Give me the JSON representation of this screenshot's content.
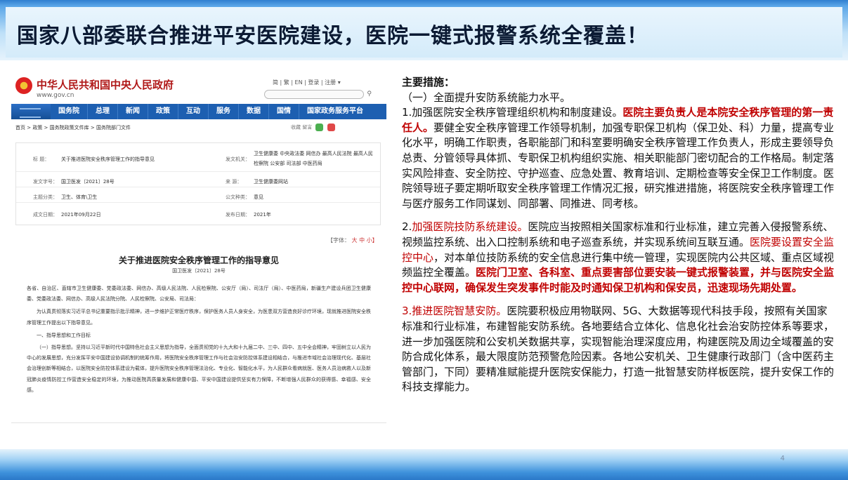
{
  "slide": {
    "title": "国家八部委联合推进平安医院建设，医院一键式报警系统全覆盖！",
    "page_number": "4"
  },
  "doc": {
    "site_name": "中华人民共和国中央人民政府",
    "site_domain": "www.gov.cn",
    "top_links": "简 | 繁 | EN | 登录 | 注册 ▾",
    "nav": [
      "国务院",
      "总理",
      "新闻",
      "政策",
      "互动",
      "服务",
      "数据",
      "国情",
      "国家政务服务平台"
    ],
    "breadcrumb": "首页 > 政策 > 国务院政策文件库 > 国务院部门文件",
    "tools": "收藏   留言",
    "meta": {
      "title_label": "标    题：",
      "title_value": "关于推进医院安全秩序管理工作的指导意见",
      "issuer_label": "发文机关：",
      "issuer_value_1": "卫生健康委  中央政法委  网信办  最高人民法院  最高人民",
      "issuer_value_2": "检察院  公安部  司法部  中医药局",
      "number_label": "发文字号：",
      "number_value": "国卫医发〔2021〕28号",
      "source_label": "来    源：",
      "source_value": "卫生健康委网站",
      "topic_label": "主题分类：",
      "topic_value": "卫生、体育\\卫生",
      "type_label": "公文种类：",
      "type_value": "意见",
      "written_label": "成文日期：",
      "written_value": "2021年09月22日",
      "published_label": "发布日期：",
      "published_value": "2021年"
    },
    "font_size_label": "【字体：",
    "font_size_big": "大",
    "font_size_mid": "中",
    "font_size_small": "小】",
    "doc_title": "关于推进医院安全秩序管理工作的指导意见",
    "doc_number": "国卫医发〔2021〕28号",
    "body_1": "各省、自治区、直辖市卫生健康委、党委政法委、网信办、高级人民法院、人民检察院、公安厅（局）、司法厅（局）、中医药局，新疆生产建设兵团卫生健康委、党委政法委、网信办、高级人民法院分院、人民检察院、公安局、司法局：",
    "body_2": "为认真贯彻落实习近平总书记重要指示批示精神，进一步维护正常医疗秩序，保护医务人员人身安全，为医患双方营造良好诊疗环境，现就推进医院安全秩序管理工作提出以下指导意见。",
    "section_1": "一、指导思想和工作目标",
    "body_3": "（一）指导思想。坚持以习近平新时代中国特色社会主义思想为指导，全面贯彻党的十九大和十九届二中、三中、四中、五中全会精神，牢固树立以人民为中心的发展思想，充分发挥平安中国建设协调机制的统筹作用，将医院安全秩序管理工作与社会治安防控体系建设相结合，与推进市域社会治理现代化、基层社会治理创新等相结合，以医院安全防控体系建设为载体，提升医院安全秩序管理法治化、专业化、智能化水平，为人民群众看病就医、医务人员治病救人以及新冠肺炎疫情防控工作营造安全稳定的环境，为推动医院高质量发展和健康中国、平安中国建设提供坚实有力保障，不断增强人民群众的获得感、幸福感、安全感。"
  },
  "measures": {
    "heading": "主要措施：",
    "sub_1": "（一）全面提升安防系统能力水平。",
    "p1_a": "1.加强医院安全秩序管理组织机构和制度建设。",
    "p1_red": "医院主要负责人是本院安全秩序管理的第一责任人。",
    "p1_b": "要健全安全秩序管理工作领导机制，加强专职保卫机构（保卫处、科）力量，提高专业化水平，明确工作职责，各职能部门和科室要明确安全秩序管理工作负责人，形成主要领导负总责、分管领导具体抓、专职保卫机构组织实施、相关职能部门密切配合的工作格局。制定落实风险排查、安全防控、守护巡查、应急处置、教育培训、定期检查等安全保卫工作制度。医院领导班子要定期听取安全秩序管理工作情况汇报，研究推进措施，将医院安全秩序管理工作与医疗服务工作同谋划、同部署、同推进、同考核。",
    "p2_num": "2.",
    "p2_red": "加强医院技防系统建设。",
    "p2_a": "医院应当按照相关国家标准和行业标准，建立完善入侵报警系统、视频监控系统、出入口控制系统和电子巡查系统，并实现系统间互联互通。",
    "p2_red2": "医院要设置安全监控中心",
    "p2_b": "，对本单位技防系统的安全信息进行集中统一管理，实现医院内公共区域、重点区域视频监控全覆盖。",
    "p2_redb": "医院门卫室、各科室、重点要害部位要安装一键式报警装置，并与医院安全监控中心联网，确保发生突发事件时能及时通知保卫机构和保安员，迅速现场先期处置。",
    "p3_red": "3.推进医院智慧安防。",
    "p3_a": "医院要积极应用物联网、5G、大数据等现代科技手段，按照有关国家标准和行业标准，布建智能安防系统。各地要结合立体化、信息化社会治安防控体系等要求，进一步加强医院和公安机关数据共享，实现智能治理深度应用，构建医院及周边全域覆盖的安防合成化体系，最大限度防范预警危险因素。各地公安机关、卫生健康行政部门（含中医药主管部门，下同）要精准赋能提升医院安保能力，打造一批智慧安防样板医院，提升安保工作的科技支撑能力。"
  },
  "colors": {
    "accent_red": "#c00000",
    "nav_blue": "#1d5fb1",
    "gov_red": "#b01818"
  }
}
